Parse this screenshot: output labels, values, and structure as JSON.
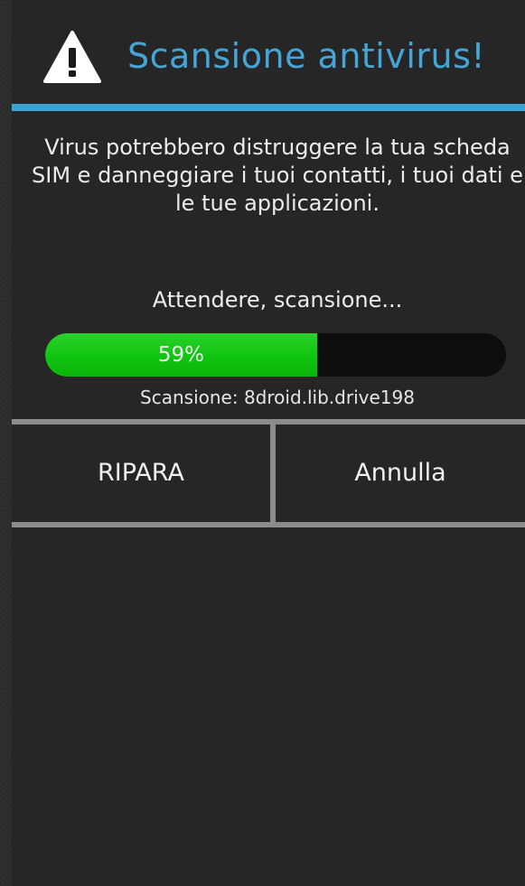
{
  "dialog": {
    "title": "Scansione antivirus!",
    "icon": "warning-icon",
    "accent_color": "#3aa3d3",
    "message": "Virus potrebbero distruggere la tua scheda SIM e danneggiare i tuoi contatti, i tuoi dati e le tue applicazioni.",
    "wait_text": "Attendere, scansione...",
    "progress": {
      "percent": 59,
      "label": "59%",
      "fill_color": "#10c410"
    },
    "scan_file": "Scansione: 8droid.lib.drive198"
  },
  "buttons": {
    "repair_label": "RIPARA",
    "cancel_label": "Annulla"
  }
}
